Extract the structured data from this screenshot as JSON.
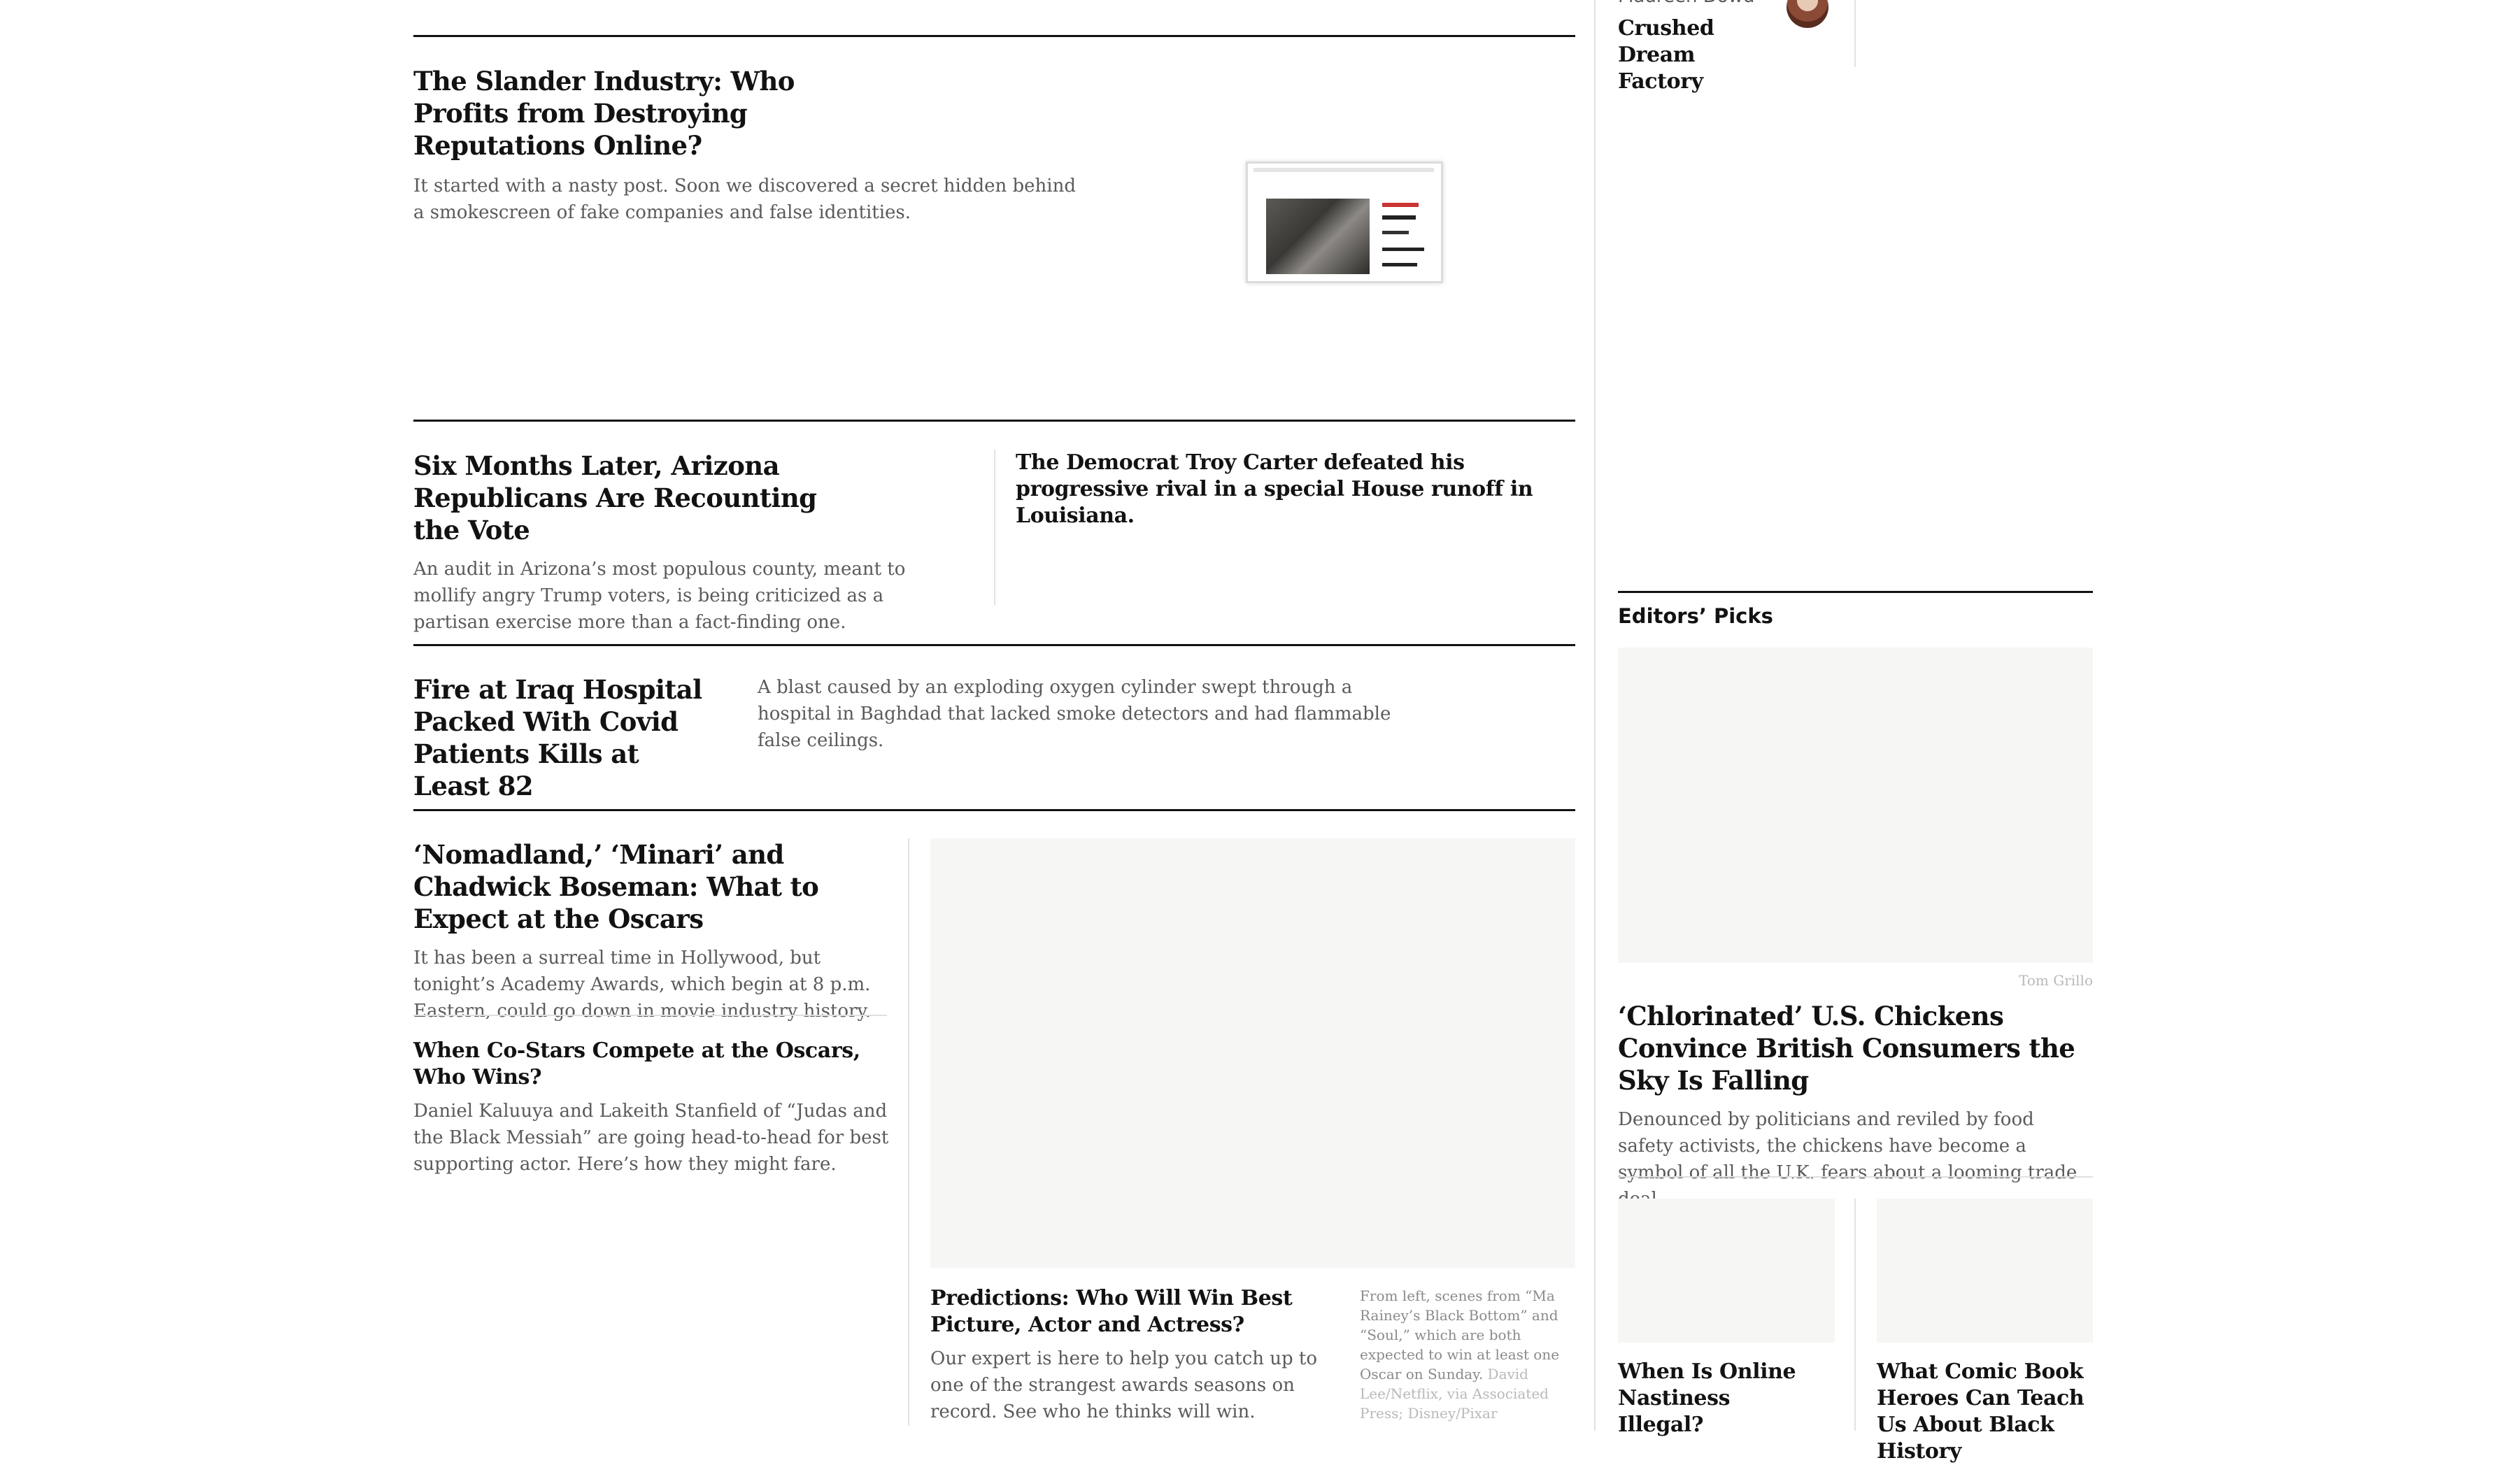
{
  "opinion_sidebar": {
    "author_partial": "Maureen Dowd",
    "headline": "Crushed Dream Factory"
  },
  "stories": {
    "slander": {
      "headline": "The Slander Industry: Who Profits from Destroying Reputations Online?",
      "summary": "It started with a nasty post. Soon we discovered a secret hidden behind a smokescreen of fake companies and false identities."
    },
    "arizona": {
      "headline": "Six Months Later, Arizona Republicans Are Recounting the Vote",
      "summary": "An audit in Arizona’s most populous county, meant to mollify angry Trump voters, is being criticized as a partisan exercise more than a fact-finding one."
    },
    "carter": {
      "headline": "The Democrat Troy Carter defeated his progressive rival in a special House runoff in Louisiana."
    },
    "iraq": {
      "headline": "Fire at Iraq Hospital Packed With Covid Patients Kills at Least 82",
      "summary": "A blast caused by an exploding oxygen cylinder swept through a hospital in Baghdad that lacked smoke detectors and had flammable false ceilings."
    },
    "oscars": {
      "headline": "‘Nomadland,’ ‘Minari’ and Chadwick Boseman: What to Expect at the Oscars",
      "summary": "It has been a surreal time in Hollywood, but tonight’s Academy Awards, which begin at 8 p.m. Eastern, could go down in movie industry history."
    },
    "costars": {
      "headline": "When Co-Stars Compete at the Oscars, Who Wins?",
      "summary": "Daniel Kaluuya and Lakeith Stanfield of “Judas and the Black Messiah” are going head-to-head for best supporting actor. Here’s how they might fare."
    },
    "predictions": {
      "headline": "Predictions: Who Will Win Best Picture, Actor and Actress?",
      "summary": "Our expert is here to help you catch up to one of the strangest awards seasons on record. See who he thinks will win.",
      "caption": "From left, scenes from “Ma Rainey’s Black Bottom” and “Soul,” which are both expected to win at least one Oscar on Sunday.",
      "credit": "David Lee/Netflix, via Associated Press; Disney/Pixar"
    }
  },
  "editors_picks": {
    "label": "Editors’ Picks",
    "image_credit": "Tom Grillo",
    "main": {
      "headline": "‘Chlorinated’ U.S. Chickens Convince British Consumers the Sky Is Falling",
      "summary": "Denounced by politicians and reviled by food safety activists, the chickens have become a symbol of all the U.K. fears about a looming trade deal."
    },
    "small": [
      {
        "headline": "When Is Online Nastiness Illegal?"
      },
      {
        "headline": "What Comic Book Heroes Can Teach Us About Black History"
      }
    ]
  }
}
